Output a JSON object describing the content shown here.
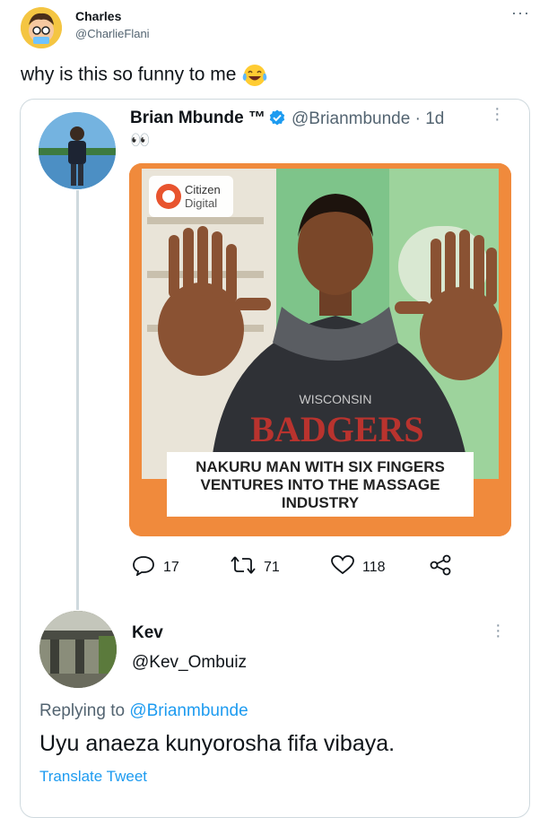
{
  "author": {
    "name": "Charles",
    "handle": "@CharlieFlani",
    "more_label": "···"
  },
  "tweet": {
    "text": "why is this so funny to me",
    "emoji": "face-with-tears-of-joy"
  },
  "quoted": {
    "name": "Brian Mbunde ™",
    "handle_time": "@Brianmbunde · 1d",
    "dots": "👀",
    "media": {
      "logo_line1": "Citizen",
      "logo_line2": "Digital",
      "shirt_text_top": "WISCONSIN",
      "shirt_text": "BADGERS",
      "caption_lines": [
        "NAKURU MAN WITH SIX FINGERS",
        "VENTURES INTO THE MASSAGE",
        "INDUSTRY"
      ],
      "frame_color": "#f08a3c"
    },
    "actions": {
      "replies": "17",
      "retweets": "71",
      "likes": "118"
    }
  },
  "reply": {
    "name": "Kev",
    "handle": "@Kev_Ombuiz",
    "replying_prefix": "Replying to",
    "replying_to": "@Brianmbunde",
    "text": "Uyu anaeza kunyorosha fifa vibaya.",
    "translate": "Translate Tweet"
  },
  "colors": {
    "link": "#1d9bf0",
    "secondary": "#536471",
    "verified": "#1d9bf0"
  }
}
